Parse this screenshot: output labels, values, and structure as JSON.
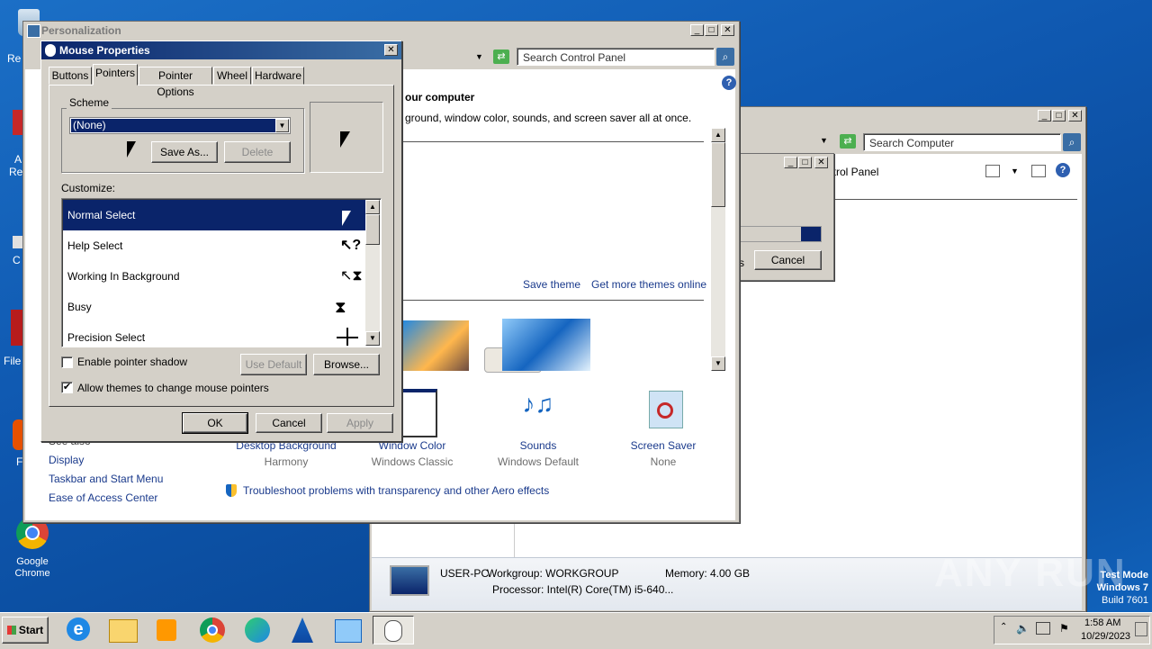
{
  "desktop": {
    "icons": [
      {
        "label": "Re"
      },
      {
        "label": "A"
      },
      {
        "label": "Re"
      },
      {
        "label": "C"
      },
      {
        "label": "File"
      },
      {
        "label": "F"
      },
      {
        "label": "Google Chrome"
      }
    ],
    "watermark": "ANY RUN",
    "test_mode": {
      "line1": "Test Mode",
      "line2": "Windows 7",
      "line3": "Build 7601"
    }
  },
  "personalization": {
    "title": "Personalization",
    "search_placeholder": "Search Control Panel",
    "heading": "our computer",
    "subtitle": "ground, window color, sounds, and screen saver all at once.",
    "save_theme": "Save theme",
    "get_more": "Get more themes online",
    "see_also": "See also",
    "left_links": [
      "Display",
      "Taskbar and Start Menu",
      "Ease of Access Center"
    ],
    "bottom_items": [
      {
        "label": "Desktop Background",
        "value": "Harmony"
      },
      {
        "label": "Window Color",
        "value": "Windows Classic"
      },
      {
        "label": "Sounds",
        "value": "Windows Default"
      },
      {
        "label": "Screen Saver",
        "value": "None"
      }
    ],
    "troubleshoot": "Troubleshoot problems with transparency and other Aero effects"
  },
  "computer_window": {
    "search_placeholder": "Search Computer",
    "breadcrumb_tail": "ntrol Panel",
    "details": {
      "name": "USER-PC",
      "workgroup": "Workgroup: WORKGROUP",
      "memory": "Memory: 4.00 GB",
      "processor": "Processor: Intel(R) Core(TM) i5-640..."
    }
  },
  "small_dialog": {
    "ok_fragment": "s",
    "cancel": "Cancel"
  },
  "mouse": {
    "title": "Mouse Properties",
    "tabs": [
      "Buttons",
      "Pointers",
      "Pointer Options",
      "Wheel",
      "Hardware"
    ],
    "scheme_label": "Scheme",
    "scheme_value": "(None)",
    "save_as": "Save As...",
    "delete": "Delete",
    "customize_label": "Customize:",
    "rows": [
      "Normal Select",
      "Help Select",
      "Working In Background",
      "Busy",
      "Precision Select"
    ],
    "shadow": "Enable pointer shadow",
    "allow_themes": "Allow themes to change mouse pointers",
    "use_default": "Use Default",
    "browse": "Browse...",
    "ok": "OK",
    "cancel": "Cancel",
    "apply": "Apply"
  },
  "taskbar": {
    "start": "Start",
    "time": "1:58 AM",
    "date": "10/29/2023"
  },
  "colors": {
    "selection": "#0a246a",
    "desktop": "#1266c0",
    "face": "#d4d0c8"
  }
}
